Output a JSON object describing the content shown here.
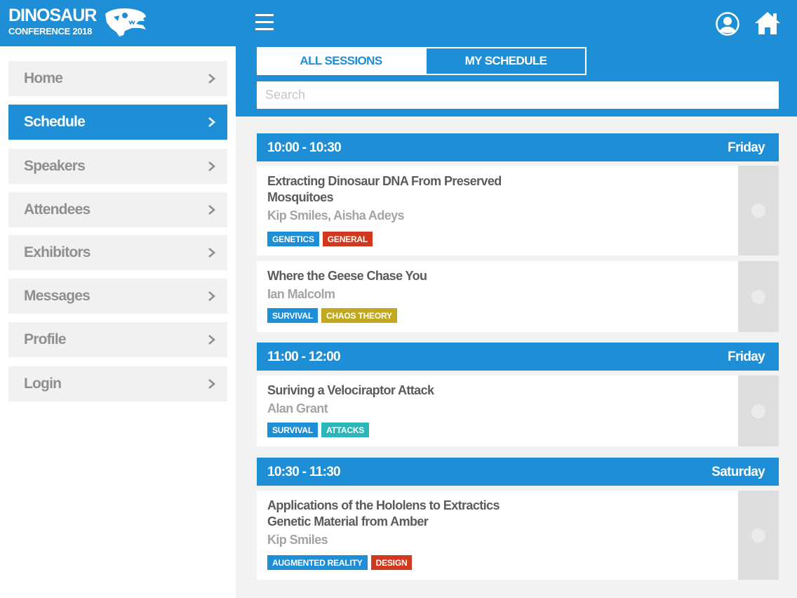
{
  "logo": {
    "line1": "DINOSAUR",
    "line2": "CONFERENCE 2018"
  },
  "sidebar": {
    "items": [
      {
        "label": "Home"
      },
      {
        "label": "Schedule",
        "active": true
      },
      {
        "label": "Speakers"
      },
      {
        "label": "Attendees"
      },
      {
        "label": "Exhibitors"
      },
      {
        "label": "Messages"
      },
      {
        "label": "Profile"
      },
      {
        "label": "Login"
      }
    ]
  },
  "header": {
    "tabs": [
      {
        "label": "ALL SESSIONS"
      },
      {
        "label": "MY SCHEDULE"
      }
    ],
    "search": {
      "placeholder": "Search",
      "value": ""
    }
  },
  "colors": {
    "accent": "#1e8fd6",
    "tag_blue": "#1e8fd6",
    "tag_red": "#d0391d",
    "tag_olive": "#c2a81c",
    "tag_teal": "#2bb7ba"
  },
  "schedule": [
    {
      "time": "10:00 - 10:30",
      "day": "Friday",
      "sessions": [
        {
          "title": "Extracting Dinosaur DNA From Preserved Mosquitoes",
          "speakers": "Kip Smiles, Aisha Adeys",
          "tags": [
            {
              "label": "GENETICS",
              "color": "#1e8fd6"
            },
            {
              "label": "GENERAL",
              "color": "#d0391d"
            }
          ]
        },
        {
          "title": "Where the Geese Chase You",
          "speakers": "Ian Malcolm",
          "tags": [
            {
              "label": "SURVIVAL",
              "color": "#1e8fd6"
            },
            {
              "label": "CHAOS THEORY",
              "color": "#c2a81c"
            }
          ]
        }
      ]
    },
    {
      "time": "11:00 - 12:00",
      "day": "Friday",
      "sessions": [
        {
          "title": "Suriving a Velociraptor Attack",
          "speakers": "Alan Grant",
          "tags": [
            {
              "label": "SURVIVAL",
              "color": "#1e8fd6"
            },
            {
              "label": "ATTACKS",
              "color": "#2bb7ba"
            }
          ]
        }
      ]
    },
    {
      "time": "10:30 - 11:30",
      "day": "Saturday",
      "sessions": [
        {
          "title": "Applications of the Hololens to Extractics Genetic Material from Amber",
          "speakers": "Kip Smiles",
          "tags": [
            {
              "label": "AUGMENTED REALITY",
              "color": "#1e8fd6"
            },
            {
              "label": "DESIGN",
              "color": "#d0391d"
            }
          ]
        }
      ]
    }
  ]
}
